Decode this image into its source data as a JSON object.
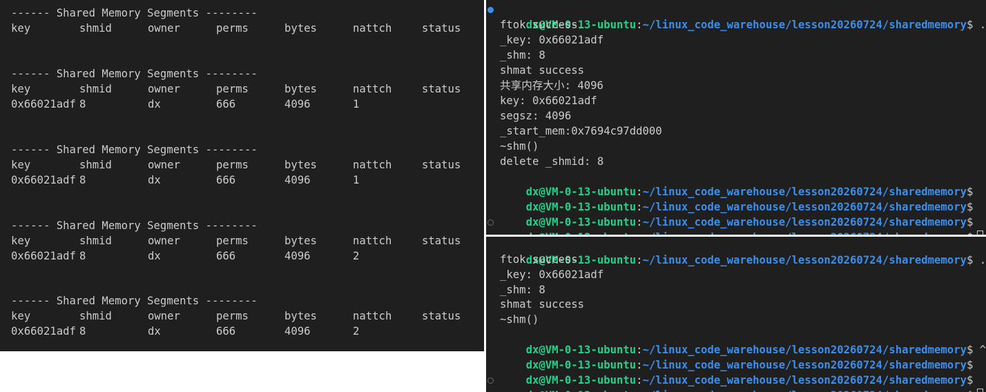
{
  "user_host": "dx@VM-0-13-ubuntu",
  "path": "~/linux_code_warehouse/lesson20260724/sharedmemory",
  "prompt_sep": ":",
  "prompt_dollar": "$",
  "ipcs": {
    "header": "------ Shared Memory Segments --------",
    "columns": [
      "key",
      "shmid",
      "owner",
      "perms",
      "bytes",
      "nattch",
      "status"
    ],
    "blocks": [
      {
        "rows": []
      },
      {
        "rows": [
          [
            "0x66021adf",
            "8",
            "dx",
            "666",
            "4096",
            "1",
            ""
          ]
        ]
      },
      {
        "rows": [
          [
            "0x66021adf",
            "8",
            "dx",
            "666",
            "4096",
            "1",
            ""
          ]
        ]
      },
      {
        "rows": [
          [
            "0x66021adf",
            "8",
            "dx",
            "666",
            "4096",
            "2",
            ""
          ]
        ]
      },
      {
        "rows": [
          [
            "0x66021adf",
            "8",
            "dx",
            "666",
            "4096",
            "2",
            ""
          ]
        ]
      }
    ]
  },
  "server_terminal": {
    "command": " ./server",
    "output": [
      "ftok success",
      "_key: 0x66021adf",
      "_shm: 8",
      "shmat success",
      "共享内存大小: 4096",
      "key: 0x66021adf",
      "segsz: 4096",
      "_start_mem:0x7694c97dd000",
      "~shm()",
      "delete _shmid: 8"
    ],
    "trailing_prompts": [
      "",
      "",
      "",
      ""
    ]
  },
  "client_terminal": {
    "command": " ./client",
    "output": [
      "ftok success",
      "_key: 0x66021adf",
      "_shm: 8",
      "shmat success",
      "~shm()"
    ],
    "trailing_prompts": [
      " ^C",
      "",
      "",
      ""
    ]
  }
}
